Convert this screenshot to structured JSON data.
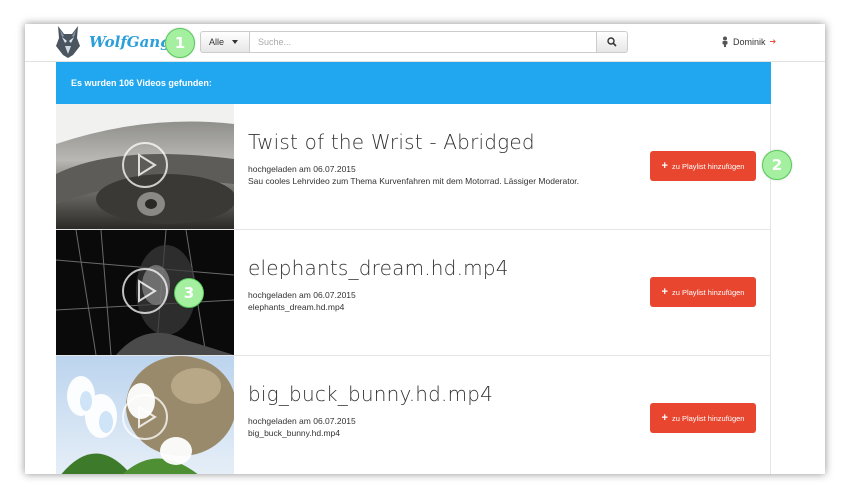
{
  "brand": {
    "name": "WolfGang"
  },
  "search": {
    "category": "Alle",
    "placeholder": "Suche..."
  },
  "user": {
    "name": "Dominik"
  },
  "banner": {
    "text": "Es wurden 106 Videos gefunden:"
  },
  "badges": [
    "1",
    "2",
    "3"
  ],
  "videos": [
    {
      "title": "Twist of the Wrist - Abridged",
      "uploaded": "hochgeladen am 06.07.2015",
      "description": "Sau cooles Lehrvideo zum Thema Kurvenfahren mit dem Motorrad. Lässiger Moderator.",
      "button": "zu Playlist hinzufügen"
    },
    {
      "title": "elephants_dream.hd.mp4",
      "uploaded": "hochgeladen am 06.07.2015",
      "description": "elephants_dream.hd.mp4",
      "button": "zu Playlist hinzufügen"
    },
    {
      "title": "big_buck_bunny.hd.mp4",
      "uploaded": "hochgeladen am 06.07.2015",
      "description": "big_buck_bunny.hd.mp4",
      "button": "zu Playlist hinzufügen"
    }
  ],
  "colors": {
    "accent": "#20a7ef",
    "button": "#e8462f",
    "badge": "#a5f0a0",
    "brand": "#2b9fd9"
  }
}
